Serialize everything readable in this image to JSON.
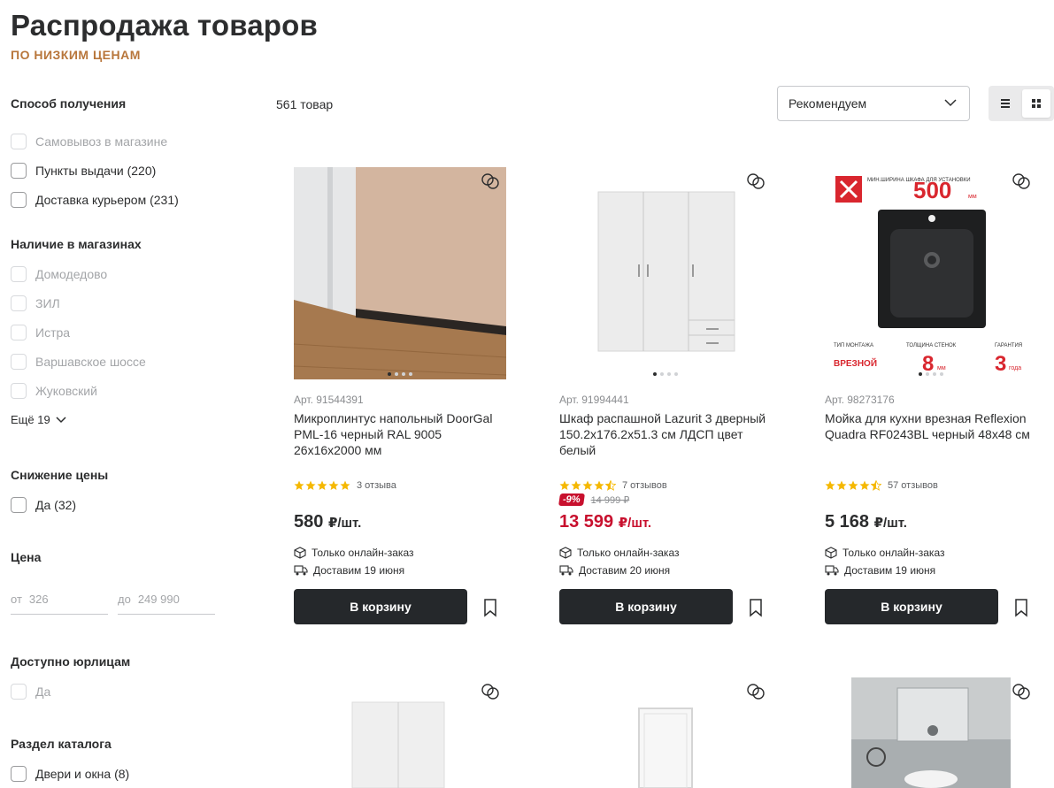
{
  "header": {
    "title": "Распродажа товаров",
    "subtitle": "ПО НИЗКИМ ЦЕНАМ"
  },
  "filters": {
    "delivery": {
      "title": "Способ получения",
      "options": [
        "Самовывоз в магазине",
        "Пункты выдачи (220)",
        "Доставка курьером (231)"
      ]
    },
    "stores": {
      "title": "Наличие в магазинах",
      "options": [
        "Домодедово",
        "ЗИЛ",
        "Истра",
        "Варшавское шоссе",
        "Жуковский"
      ],
      "more": "Ещё 19"
    },
    "discount": {
      "title": "Снижение цены",
      "options": [
        "Да (32)"
      ]
    },
    "price": {
      "title": "Цена",
      "from_label": "от",
      "from_placeholder": "326",
      "to_label": "до",
      "to_placeholder": "249 990"
    },
    "legal": {
      "title": "Доступно юрлицам",
      "options": [
        "Да"
      ]
    },
    "catalog": {
      "title": "Раздел каталога",
      "options": [
        "Двери и окна (8)"
      ]
    }
  },
  "toolbar": {
    "count": "561 товар",
    "sort_value": "Рекомендуем"
  },
  "products": [
    {
      "article": "Арт. 91544391",
      "title": "Микроплинтус напольный DoorGal PML-16 черный RAL 9005 26x16x2000 мм",
      "rating": 5,
      "reviews": "3 отзыва",
      "price": "580",
      "unit": "₽/шт.",
      "online": "Только онлайн-заказ",
      "delivery": "Доставим 19 июня",
      "cart": "В корзину"
    },
    {
      "article": "Арт. 91994441",
      "title": "Шкаф распашной Lazurit 3 дверный 150.2x176.2x51.3 см ЛДСП цвет белый",
      "rating": 4.5,
      "reviews": "7 отзывов",
      "discount": "-9%",
      "old_price": "14 999 ₽",
      "price": "13 599",
      "unit": "₽/шт.",
      "online": "Только онлайн-заказ",
      "delivery": "Доставим 20 июня",
      "cart": "В корзину"
    },
    {
      "article": "Арт. 98273176",
      "title": "Мойка для кухни врезная Reflexion Quadra RF0243BL черный 48x48 см",
      "rating": 4.5,
      "reviews": "57 отзывов",
      "price": "5 168",
      "unit": "₽/шт.",
      "online": "Только онлайн-заказ",
      "delivery": "Доставим 19 июня",
      "cart": "В корзину",
      "promo": {
        "min_width_label": "МИН.ШИРИНА ШКАФА ДЛЯ УСТАНОВКИ",
        "min_width_value": "500",
        "min_width_unit": "мм",
        "mount_label": "ТИП МОНТАЖА",
        "mount_value": "ВРЕЗНОЙ",
        "wall_label": "ТОЛЩИНА СТЕНОК",
        "wall_value": "8",
        "wall_unit": "мм",
        "warranty_label": "ГАРАНТИЯ",
        "warranty_value": "3",
        "warranty_unit": "года"
      }
    }
  ],
  "colors": {
    "accent_subtitle": "#b8763b",
    "button_dark": "#25282b",
    "sale_red": "#c8102e",
    "star": "#f5b800"
  },
  "icons": {
    "compare": "compare-icon",
    "favorite": "bookmark-icon",
    "online": "box-icon",
    "delivery": "truck-icon"
  }
}
